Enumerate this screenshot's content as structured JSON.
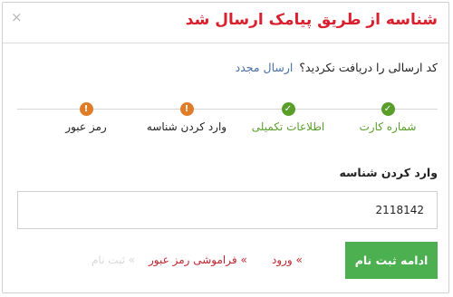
{
  "dialog": {
    "title": "شناسه از طریق پیامک ارسال شد",
    "close_symbol": "×"
  },
  "resend": {
    "question": "کد ارسالی را دریافت نکردید؟",
    "link": "ارسال مجدد"
  },
  "steps": [
    {
      "label": "شماره کارت",
      "status": "done",
      "icon": "check-icon",
      "glyph": "✓"
    },
    {
      "label": "اطلاعات تکمیلی",
      "status": "done",
      "icon": "check-icon",
      "glyph": "✓"
    },
    {
      "label": "وارد کردن شناسه",
      "status": "pending",
      "icon": "exclamation-icon",
      "glyph": "!"
    },
    {
      "label": "رمز عبور",
      "status": "pending",
      "icon": "exclamation-icon",
      "glyph": "!"
    }
  ],
  "form": {
    "label": "وارد کردن شناسه",
    "value": "2118142"
  },
  "actions": {
    "continue": "ادامه ثبت نام",
    "login": "» ورود",
    "forgot": "» فراموشی رمز عبور",
    "register": "» ثبت نام"
  },
  "colors": {
    "title": "#d9202f",
    "done": "#5a9e2a",
    "pending": "#e07b28",
    "button": "#4caf50",
    "link": "#4a6fa5"
  }
}
